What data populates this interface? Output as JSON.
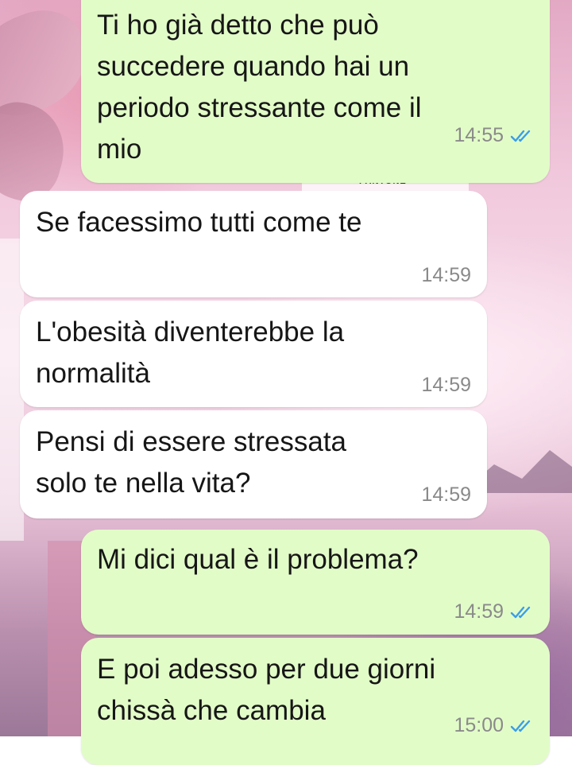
{
  "chat": {
    "watermark": "PANTONE",
    "messages": [
      {
        "direction": "outgoing",
        "text": "Ti ho già detto che può\nsuccedere quando hai un\nperiodo stressante come il\nmio",
        "time": "14:55",
        "status": "read",
        "status_icon": "double-check-icon"
      },
      {
        "direction": "incoming",
        "text": "Se facessimo tutti come te",
        "time": "14:59"
      },
      {
        "direction": "incoming",
        "text": "L'obesità diventerebbe la\nnormalità",
        "time": "14:59"
      },
      {
        "direction": "incoming",
        "text": "Pensi di essere stressata\nsolo te nella vita?",
        "time": "14:59"
      },
      {
        "direction": "outgoing",
        "text": "Mi dici qual è il problema?",
        "time": "14:59",
        "status": "read",
        "status_icon": "double-check-icon"
      },
      {
        "direction": "outgoing",
        "text": "E poi adesso per due giorni\nchissà che cambia",
        "time": "15:00",
        "status": "read",
        "status_icon": "double-check-icon"
      }
    ]
  },
  "colors": {
    "outgoing_bubble": "#e2fcc8",
    "incoming_bubble": "#ffffff",
    "read_ticks": "#3b9ee8",
    "timestamp": "#8a8a8a"
  }
}
